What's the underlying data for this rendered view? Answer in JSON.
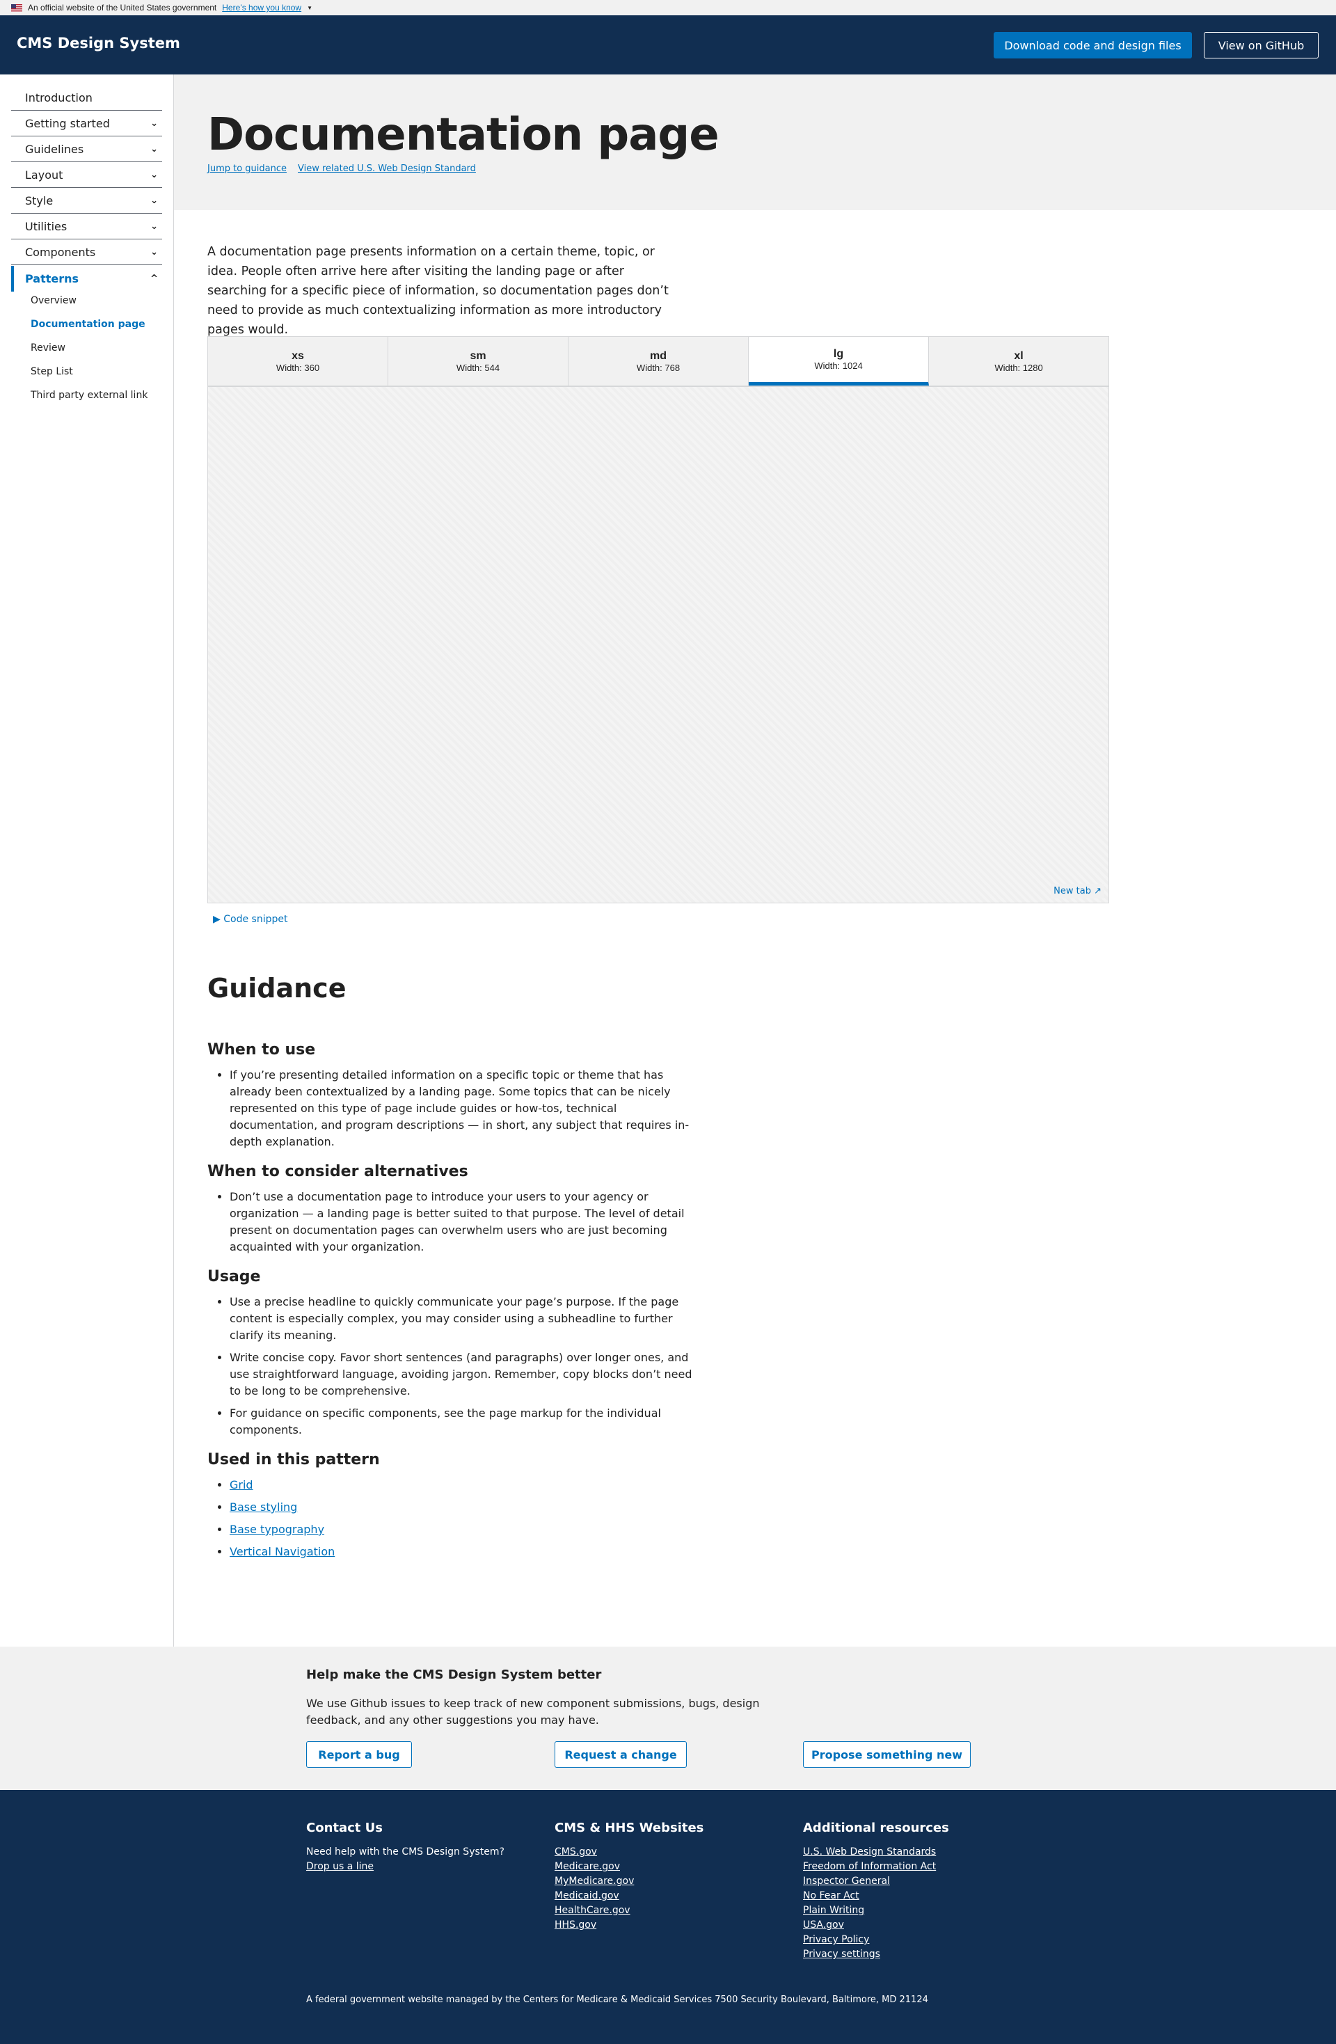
{
  "banner": {
    "text": "An official website of the United States government",
    "link": "Here’s how you know"
  },
  "header": {
    "logo": "CMS Design System",
    "download": "Download code and design files",
    "github": "View on GitHub"
  },
  "sidebar": {
    "items": [
      {
        "label": "Introduction"
      },
      {
        "label": "Getting started"
      },
      {
        "label": "Guidelines"
      },
      {
        "label": "Layout"
      },
      {
        "label": "Style"
      },
      {
        "label": "Utilities"
      },
      {
        "label": "Components"
      },
      {
        "label": "Patterns"
      }
    ],
    "sub": [
      "Overview",
      "Documentation page",
      "Review",
      "Step List",
      "Third party external link"
    ]
  },
  "hero": {
    "title": "Documentation page",
    "link1": "Jump to guidance",
    "link2": "View related U.S. Web Design Standard"
  },
  "intro": "A documentation page presents information on a certain theme, topic, or idea. People often arrive here after visiting the landing page or after searching for a specific piece of information, so documentation pages don’t need to provide as much contextualizing information as more introductory pages would.",
  "preview": {
    "tabs": [
      {
        "name": "xs",
        "width": "Width: 360"
      },
      {
        "name": "sm",
        "width": "Width: 544"
      },
      {
        "name": "md",
        "width": "Width: 768"
      },
      {
        "name": "lg",
        "width": "Width: 1024"
      },
      {
        "name": "xl",
        "width": "Width: 1280"
      }
    ],
    "selected": "lg",
    "new_tab": "New tab",
    "code_snippet": "Code snippet"
  },
  "guidance": {
    "title": "Guidance",
    "when_h": "When to use",
    "when": [
      "If you’re presenting detailed information on a specific topic or theme that has already been contextualized by a landing page. Some topics that can be nicely represented on this type of page include guides or how-tos, technical documentation, and program descriptions — in short, any subject that requires in-depth explanation."
    ],
    "alt_h": "When to consider alternatives",
    "alt": [
      "Don’t use a documentation page to introduce your users to your agency or organization — a landing page is better suited to that purpose. The level of detail present on documentation pages can overwhelm users who are just becoming acquainted with your organization."
    ],
    "usage_h": "Usage",
    "usage": [
      "Use a precise headline to quickly communicate your page’s purpose. If the page content is especially complex, you may consider using a subheadline to further clarify its meaning.",
      "Write concise copy. Favor short sentences (and paragraphs) over longer ones, and use straightforward language, avoiding jargon. Remember, copy blocks don’t need to be long to be comprehensive.",
      "For guidance on specific components, see the page markup for the individual components."
    ],
    "used_h": "Used in this pattern",
    "used": [
      "Grid",
      "Base styling",
      "Base typography",
      "Vertical Navigation"
    ]
  },
  "feedback": {
    "title": "Help make the CMS Design System better",
    "text": "We use Github issues to keep track of new component submissions, bugs, design feedback, and any other suggestions you may have.",
    "b1": "Report a bug",
    "b2": "Request a change",
    "b3": "Propose something new"
  },
  "footer": {
    "contact_h": "Contact Us",
    "contact_text": "Need help with the CMS Design System?",
    "contact_link": "Drop us a line",
    "cms_h": "CMS & HHS Websites",
    "cms": [
      "CMS.gov",
      "Medicare.gov",
      "MyMedicare.gov",
      "Medicaid.gov",
      "HealthCare.gov",
      "HHS.gov"
    ],
    "res_h": "Additional resources",
    "res": [
      "U.S. Web Design Standards",
      "Freedom of Information Act",
      "Inspector General",
      "No Fear Act",
      "Plain Writing",
      "USA.gov",
      "Privacy Policy",
      "Privacy settings"
    ],
    "bottom": "A federal government website managed by the Centers for Medicare & Medicaid Services 7500 Security Boulevard, Baltimore, MD 21124"
  },
  "colors": {
    "navy": "#112e51",
    "primary": "#0071bc",
    "gray": "#f1f1f1"
  }
}
